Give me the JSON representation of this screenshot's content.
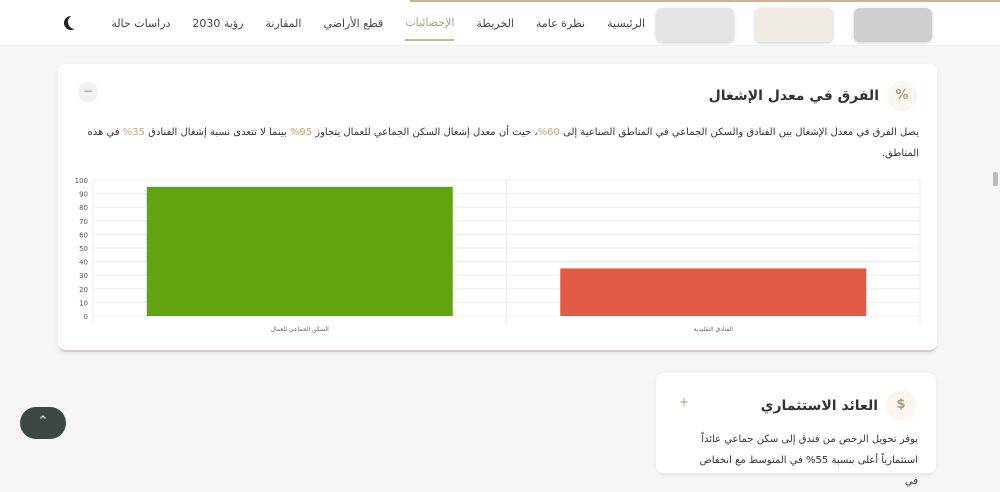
{
  "nav": {
    "items": [
      "الرئيسية",
      "نظرة عامة",
      "الخريطة",
      "الإحصائيات",
      "قطع الأراضي",
      "المقارنة",
      "رؤية 2030",
      "دراسات حالة"
    ],
    "active": "الإحصائيات"
  },
  "card1": {
    "title": "الفرق في معدل الإشغال",
    "icon": "%",
    "toggle": "−",
    "text_a": "يصل الفرق في معدل الإشغال بين الفنادق والسكن الجماعي في المناطق الصناعية إلى ",
    "h1": "60%",
    "text_b": "، حيث أن معدل إشغال السكن الجماعي للعمال يتجاوز ",
    "h2": "95%",
    "text_c": " بينما لا تتعدى نسبة إشغال الفنادق ",
    "h3": "35%",
    "text_d": " في هذه المناطق."
  },
  "card2": {
    "title": "العائد الاستثماري",
    "icon": "$",
    "toggle": "+",
    "text": "يوفر تحويل الرخص من فندق إلى سكن جماعي عائداً استثمارياً أعلى بنسبة 55% في المتوسط مع انخفاض في"
  },
  "chart_data": {
    "type": "bar",
    "categories": [
      "السكن الجماعي للعمال",
      "الفنادق التقليدية"
    ],
    "values": [
      95,
      35
    ],
    "colors": [
      "#62a30f",
      "#e05a44"
    ],
    "ylim": [
      0,
      100
    ],
    "yticks": [
      0,
      10,
      20,
      30,
      40,
      50,
      60,
      70,
      80,
      90,
      100
    ],
    "grid": true
  },
  "scroll_top": "⌃"
}
